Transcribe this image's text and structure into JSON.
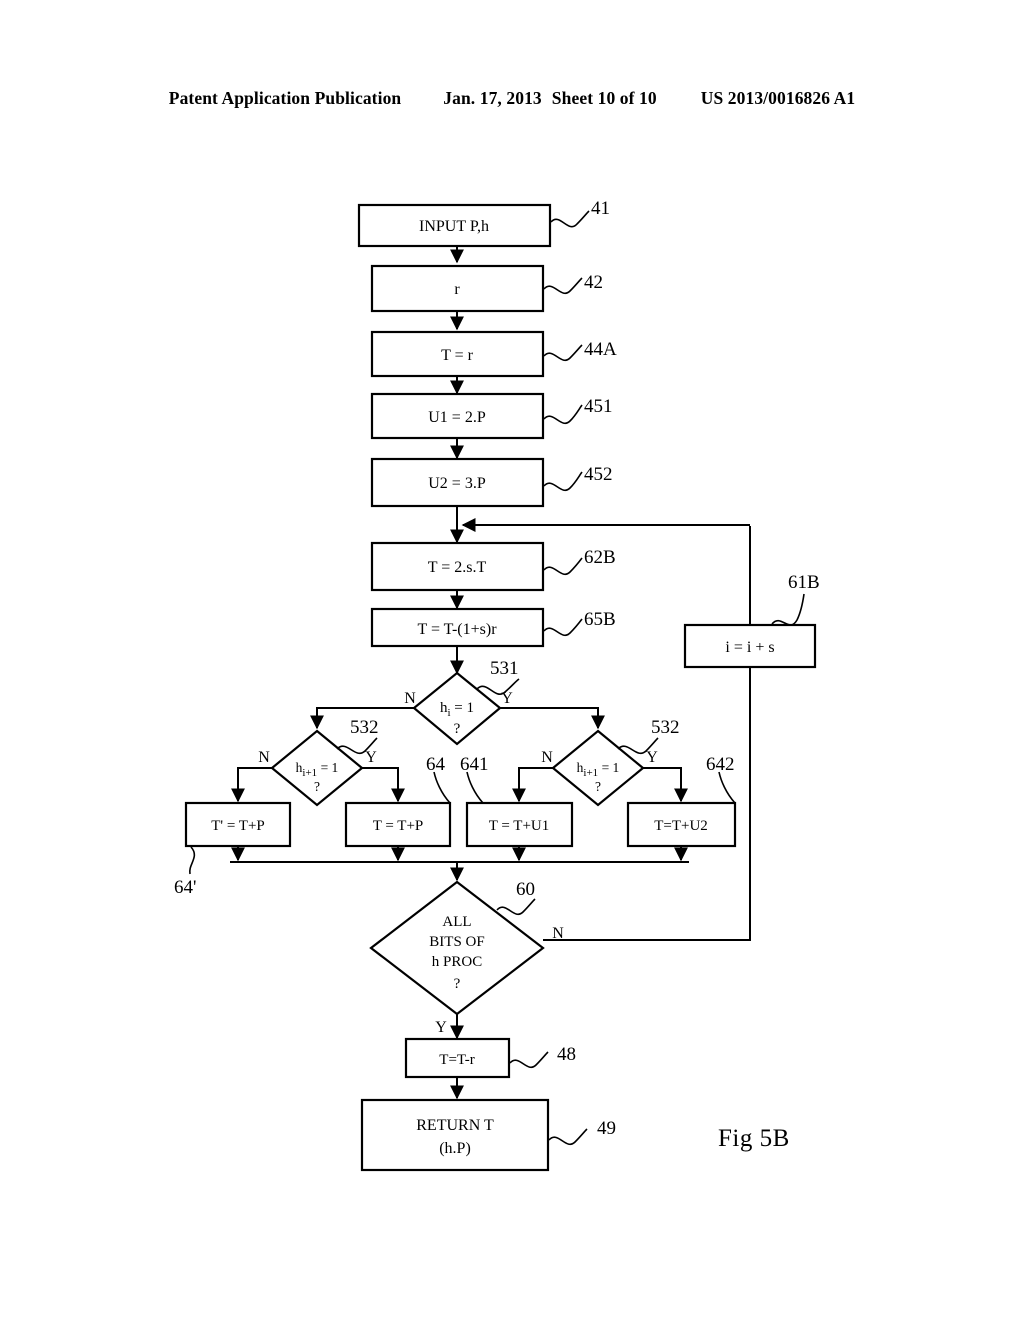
{
  "header": {
    "publication": "Patent Application Publication",
    "date": "Jan. 17, 2013",
    "sheet": "Sheet 10 of 10",
    "pub_number": "US 2013/0016826 A1"
  },
  "figure": {
    "caption": "Fig 5B",
    "type": "flowchart"
  },
  "nodes": {
    "n41": {
      "text": "INPUT P,h",
      "ref": "41",
      "shape": "rect"
    },
    "n42": {
      "text": "r",
      "ref": "42",
      "shape": "rect"
    },
    "n44A": {
      "text": "T = r",
      "ref": "44A",
      "shape": "rect"
    },
    "n451": {
      "text": "U1 = 2.P",
      "ref": "451",
      "shape": "rect"
    },
    "n452": {
      "text": "U2 = 3.P",
      "ref": "452",
      "shape": "rect"
    },
    "n62B": {
      "text": "T = 2.s.T",
      "ref": "62B",
      "shape": "rect"
    },
    "n65B": {
      "text": "T = T-(1+s)r",
      "ref": "65B",
      "shape": "rect"
    },
    "n61B": {
      "text": "i = i + s",
      "ref": "61B",
      "shape": "rect"
    },
    "n531": {
      "text_main": "h",
      "text_sub": "i",
      "text_rest": " = 1",
      "text_q": "?",
      "ref": "531",
      "shape": "diamond"
    },
    "n532L": {
      "text_main": "h",
      "text_sub": "i+1",
      "text_rest": " = 1",
      "text_q": "?",
      "ref": "532",
      "shape": "diamond"
    },
    "n532R": {
      "text_main": "h",
      "text_sub": "i+1",
      "text_rest": " = 1",
      "text_q": "?",
      "ref": "532",
      "shape": "diamond"
    },
    "n64p": {
      "text": "T' = T+P",
      "ref": "64'",
      "shape": "rect"
    },
    "n64": {
      "text": "T = T+P",
      "ref": "64",
      "shape": "rect"
    },
    "n641": {
      "text": "T = T+U1",
      "ref": "641",
      "shape": "rect"
    },
    "n642": {
      "text": "T=T+U2",
      "ref": "642",
      "shape": "rect"
    },
    "n60": {
      "line1": "ALL",
      "line2": "BITS OF",
      "line3": "h PROC",
      "line4": "?",
      "ref": "60",
      "shape": "diamond"
    },
    "n48": {
      "text": "T=T-r",
      "ref": "48",
      "shape": "rect"
    },
    "n49": {
      "line1": "RETURN T",
      "line2": "(h.P)",
      "ref": "49",
      "shape": "rect"
    }
  },
  "branch_labels": {
    "n531_no": "N",
    "n531_yes": "Y",
    "n532L_no": "N",
    "n532L_yes": "Y",
    "n532R_no": "N",
    "n532R_yes": "Y",
    "n60_no": "N",
    "n60_yes": "Y"
  },
  "colors": {
    "ink": "#000000",
    "paper": "#ffffff"
  }
}
